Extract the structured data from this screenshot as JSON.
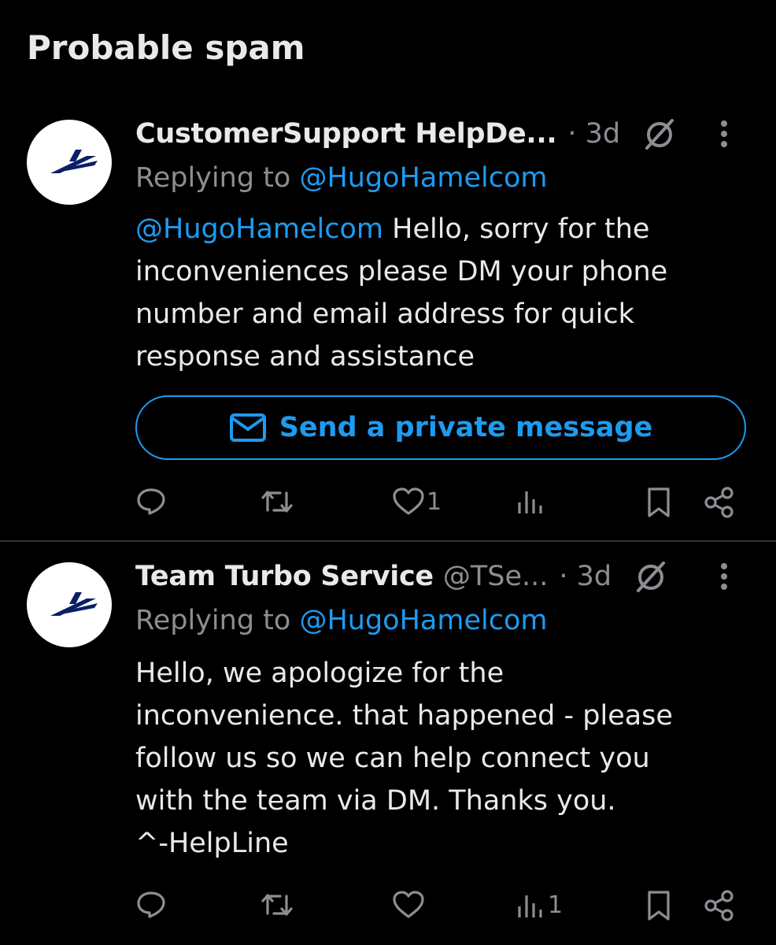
{
  "section": {
    "title": "Probable spam"
  },
  "colors": {
    "accent": "#1d9bf0",
    "muted": "#8b8e92",
    "text": "#e7e9ea",
    "background": "#000000"
  },
  "tweets": [
    {
      "display_name": "CustomerSupport HelpDe...",
      "handle": "",
      "dot_time": "· 3d",
      "replying_prefix": "Replying to ",
      "replying_to": "@HugoHamelcom",
      "body_mention": "@HugoHamelcom",
      "body_text": " Hello, sorry for the inconveniences please DM your phone number and email address for quick response and assistance",
      "dm_button_label": "Send a private message",
      "likes_count": "1",
      "views_count": "",
      "icons": [
        "reply-icon",
        "retweet-icon",
        "like-icon",
        "views-icon",
        "bookmark-icon",
        "share-icon"
      ]
    },
    {
      "display_name": "Team Turbo Service",
      "handle": "@TSe...",
      "dot_time": "· 3d",
      "replying_prefix": "Replying to ",
      "replying_to": "@HugoHamelcom",
      "body_lines": [
        "Hello, we apologize for the",
        "inconvenience. that happened - please",
        "follow us so we can help connect you",
        "with the team via DM. Thanks you.",
        "^-HelpLine"
      ],
      "likes_count": "",
      "views_count": "1",
      "icons": [
        "reply-icon",
        "retweet-icon",
        "like-icon",
        "views-icon",
        "bookmark-icon",
        "share-icon"
      ]
    }
  ]
}
